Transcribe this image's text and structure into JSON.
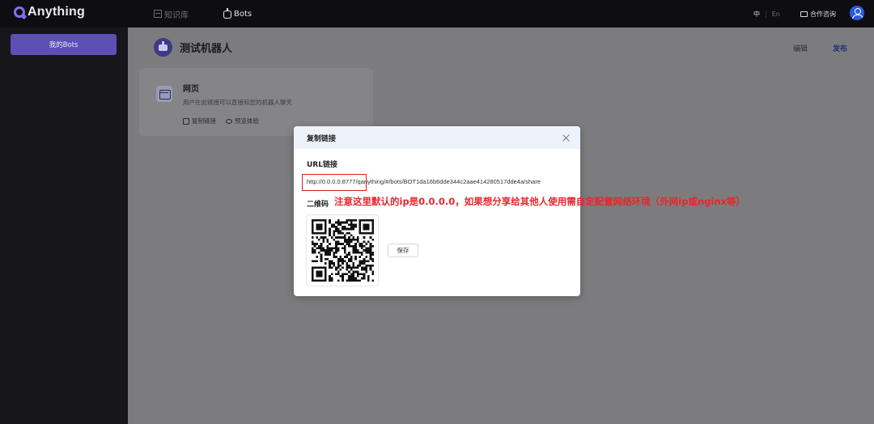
{
  "app": {
    "brand": "Anything"
  },
  "topnav": {
    "knowledge_base": "知识库",
    "bots": "Bots"
  },
  "header_right": {
    "lang_zh": "中",
    "lang_sep": "|",
    "lang_en": "En",
    "contact": "合作咨询"
  },
  "sidebar": {
    "my_bots": "我的Bots"
  },
  "bot": {
    "name": "测试机器人",
    "edit": "编辑",
    "publish": "发布"
  },
  "channel_card": {
    "title": "网页",
    "description": "用户在此链接可以直接和您的机器人聊天",
    "copy_link": "复制链接",
    "preview": "预览体验"
  },
  "modal": {
    "title": "复制链接",
    "url_label": "URL链接",
    "url": "http://0.0.0.0:8777/qanything/#/bots/BOT1da16b6dde344c2aae414280517dde4a/share",
    "qr_label": "二维码",
    "save": "保存"
  },
  "annotation": {
    "note": "注意这里默认的ip是0.0.0.0，如果想分享给其他人使用需自定配置网络环境（外网ip或nginx等）"
  },
  "colors": {
    "accent": "#5e4fb5",
    "publish": "#23307a",
    "annotation_red": "#e8262b",
    "avatar_blue": "#2a5ae0"
  },
  "icons": [
    "logo-icon",
    "knowledge-base-icon",
    "bot-icon",
    "mail-icon",
    "user-avatar-icon",
    "webpage-icon",
    "copy-icon",
    "eye-icon",
    "close-icon",
    "qr-code"
  ]
}
